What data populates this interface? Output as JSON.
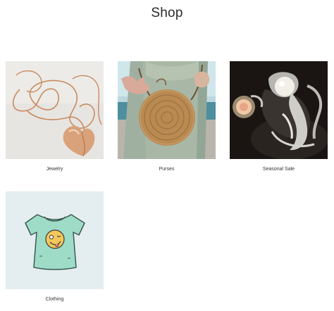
{
  "page": {
    "title": "Shop"
  },
  "categories": [
    {
      "label": "Jewelry",
      "image": "gold-heart-necklace-photo"
    },
    {
      "label": "Purses",
      "image": "woven-round-rattan-bag-photo"
    },
    {
      "label": "Seasonal Sale",
      "image": "diamond-pearl-rings-photo"
    },
    {
      "label": "Clothing",
      "image": "mint-tshirt-emoji-illustration"
    }
  ],
  "colors": {
    "background": "#ffffff",
    "text": "#333333"
  }
}
